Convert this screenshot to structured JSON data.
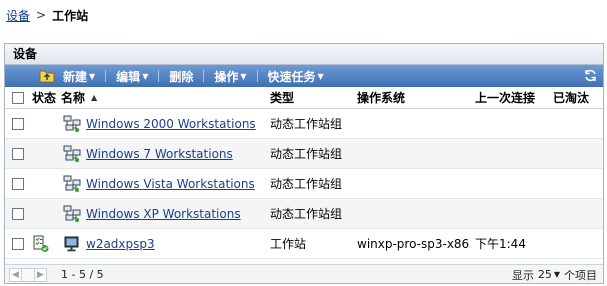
{
  "breadcrumb": {
    "root": "设备",
    "separator": ">",
    "current": "工作站"
  },
  "panel": {
    "title": "设备"
  },
  "toolbar": {
    "new_label": "新建",
    "edit_label": "编辑",
    "delete_label": "删除",
    "action_label": "操作",
    "quick_tasks_label": "快速任务"
  },
  "columns": {
    "status": "状态",
    "name": "名称",
    "type": "类型",
    "os": "操作系统",
    "last_contact": "上一次连接",
    "retired": "已淘汰"
  },
  "rows": [
    {
      "name": "Windows 2000 Workstations",
      "type": "动态工作站组",
      "os": "",
      "last_contact": "",
      "retired": ""
    },
    {
      "name": "Windows 7 Workstations",
      "type": "动态工作站组",
      "os": "",
      "last_contact": "",
      "retired": ""
    },
    {
      "name": "Windows Vista Workstations",
      "type": "动态工作站组",
      "os": "",
      "last_contact": "",
      "retired": ""
    },
    {
      "name": "Windows XP Workstations",
      "type": "动态工作站组",
      "os": "",
      "last_contact": "",
      "retired": ""
    },
    {
      "name": "w2adxpsp3",
      "type": "工作站",
      "os": "winxp-pro-sp3-x86",
      "last_contact": "下午1:44",
      "retired": ""
    }
  ],
  "footer": {
    "range": "1 - 5 / 5",
    "show_label": "显示",
    "page_size": "25",
    "items_label": "个项目"
  },
  "colors": {
    "toolbar_top": "#6f9ad4",
    "toolbar_bottom": "#3f6fb3",
    "link": "#1a3f8f",
    "status_ok": "#3aa23a"
  }
}
